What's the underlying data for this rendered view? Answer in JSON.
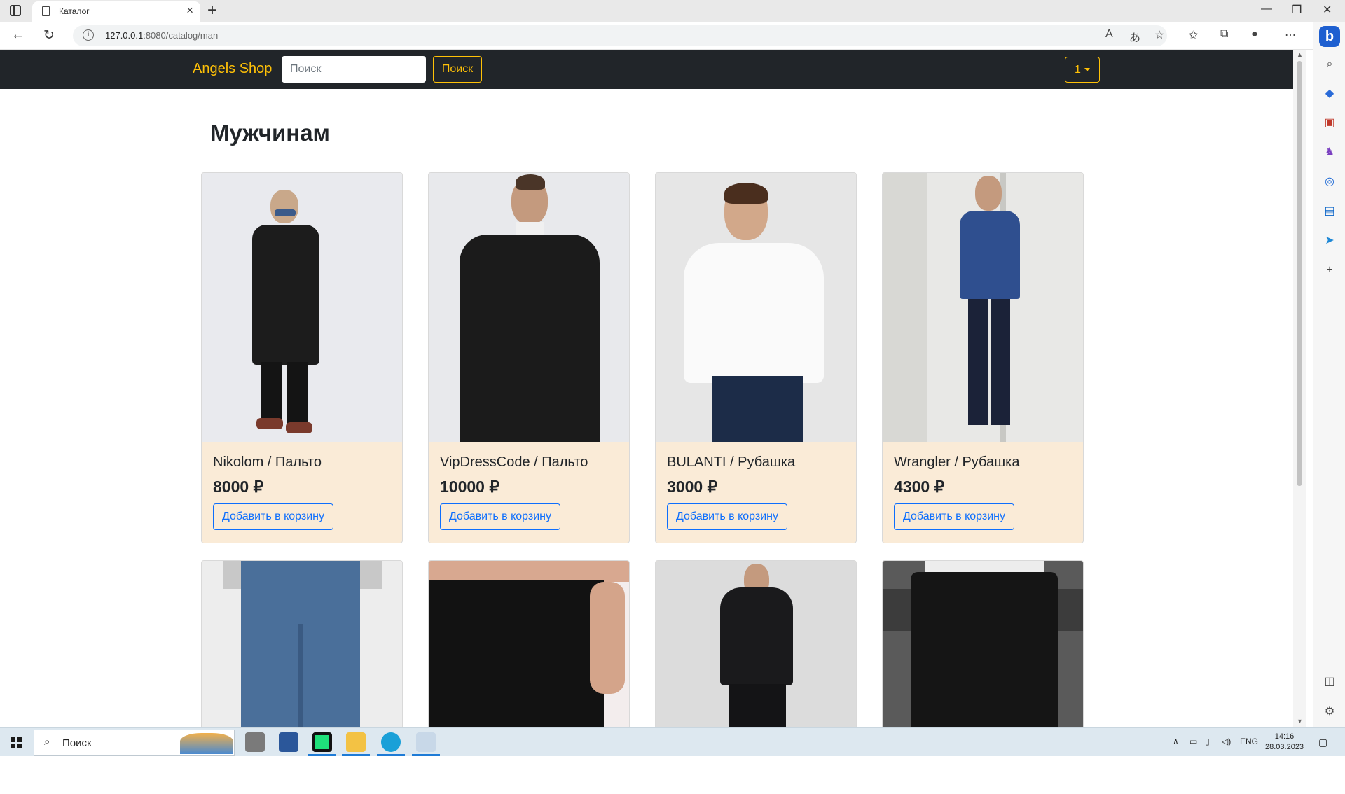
{
  "browser": {
    "tab_title": "Каталог",
    "url_host": "127.0.0.1",
    "url_rest": ":8080/catalog/man"
  },
  "nav": {
    "brand": "Angels Shop",
    "search_placeholder": "Поиск",
    "search_button": "Поиск",
    "user_button": "1"
  },
  "page": {
    "title": "Мужчинам"
  },
  "products": [
    {
      "title": "Nikolom / Пальто",
      "price": "8000 ₽",
      "button": "Добавить в корзину"
    },
    {
      "title": "VipDressCode / Пальто",
      "price": "10000 ₽",
      "button": "Добавить в корзину"
    },
    {
      "title": "BULANTI / Рубашка",
      "price": "3000 ₽",
      "button": "Добавить в корзину"
    },
    {
      "title": "Wrangler / Рубашка",
      "price": "4300 ₽",
      "button": "Добавить в корзину"
    }
  ],
  "taskbar": {
    "search_placeholder": "Поиск",
    "lang": "ENG",
    "time": "14:16",
    "date": "28.03.2023"
  },
  "colors": {
    "navbar": "#212529",
    "accent": "#ffc107",
    "card_bg": "#faebd7",
    "button_blue": "#0d6efd"
  }
}
